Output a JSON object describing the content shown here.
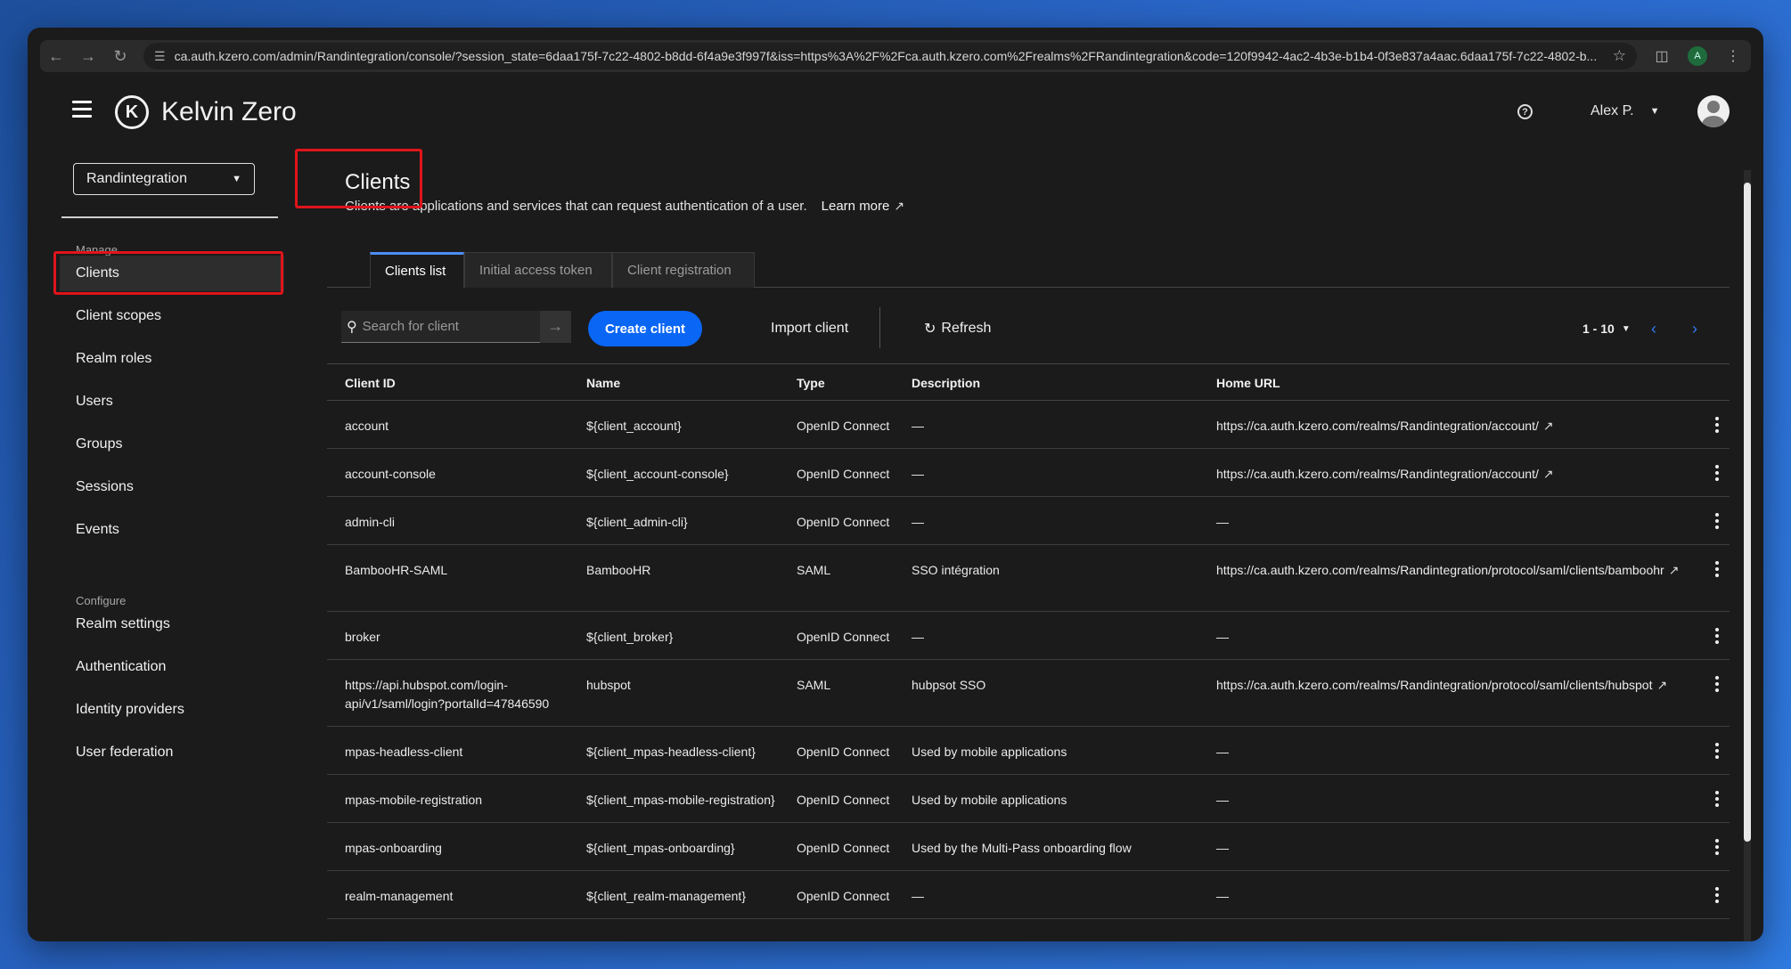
{
  "browser": {
    "url": "ca.auth.kzero.com/admin/Randintegration/console/?session_state=6daa175f-7c22-4802-b8dd-6f4a9e3f997f&iss=https%3A%2F%2Fca.auth.kzero.com%2Frealms%2FRandintegration&code=120f9942-4ac2-4b3e-b1b4-0f3e837a4aac.6daa175f-7c22-4802-b...",
    "profile_initial": "A"
  },
  "header": {
    "brand": "Kelvin Zero",
    "logo_glyph": "K",
    "user_name": "Alex P."
  },
  "sidebar": {
    "realm": "Randintegration",
    "manage_label": "Manage",
    "configure_label": "Configure",
    "manage_items": [
      "Clients",
      "Client scopes",
      "Realm roles",
      "Users",
      "Groups",
      "Sessions",
      "Events"
    ],
    "configure_items": [
      "Realm settings",
      "Authentication",
      "Identity providers",
      "User federation"
    ]
  },
  "page": {
    "title": "Clients",
    "description": "Clients are applications and services that can request authentication of a user.",
    "learn_more": "Learn more"
  },
  "tabs": [
    "Clients list",
    "Initial access token",
    "Client registration"
  ],
  "toolbar": {
    "search_placeholder": "Search for client",
    "create_label": "Create client",
    "import_label": "Import client",
    "refresh_label": "Refresh",
    "pagination": "1 - 10"
  },
  "table": {
    "columns": [
      "Client ID",
      "Name",
      "Type",
      "Description",
      "Home URL"
    ],
    "rows": [
      {
        "id": "account",
        "name": "${client_account}",
        "type": "OpenID Connect",
        "desc": "—",
        "url": "https://ca.auth.kzero.com/realms/Randintegration/account/"
      },
      {
        "id": "account-console",
        "name": "${client_account-console}",
        "type": "OpenID Connect",
        "desc": "—",
        "url": "https://ca.auth.kzero.com/realms/Randintegration/account/"
      },
      {
        "id": "admin-cli",
        "name": "${client_admin-cli}",
        "type": "OpenID Connect",
        "desc": "—",
        "url": "—"
      },
      {
        "id": "BambooHR-SAML",
        "name": "BambooHR",
        "type": "SAML",
        "desc": "SSO intégration",
        "url": "https://ca.auth.kzero.com/realms/Randintegration/protocol/saml/clients/bamboohr"
      },
      {
        "id": "broker",
        "name": "${client_broker}",
        "type": "OpenID Connect",
        "desc": "—",
        "url": "—"
      },
      {
        "id": "https://api.hubspot.com/login-api/v1/saml/login?portalId=47846590",
        "name": "hubspot",
        "type": "SAML",
        "desc": "hubpsot SSO",
        "url": "https://ca.auth.kzero.com/realms/Randintegration/protocol/saml/clients/hubspot"
      },
      {
        "id": "mpas-headless-client",
        "name": "${client_mpas-headless-client}",
        "type": "OpenID Connect",
        "desc": "Used by mobile applications",
        "url": "—"
      },
      {
        "id": "mpas-mobile-registration",
        "name": "${client_mpas-mobile-registration}",
        "type": "OpenID Connect",
        "desc": "Used by mobile applications",
        "url": "—"
      },
      {
        "id": "mpas-onboarding",
        "name": "${client_mpas-onboarding}",
        "type": "OpenID Connect",
        "desc": "Used by the Multi-Pass onboarding flow",
        "url": "—"
      },
      {
        "id": "realm-management",
        "name": "${client_realm-management}",
        "type": "OpenID Connect",
        "desc": "—",
        "url": "—"
      }
    ]
  },
  "colors": {
    "accent": "#0a66f5",
    "highlight": "#e0141a",
    "background": "#1b1b1b"
  }
}
